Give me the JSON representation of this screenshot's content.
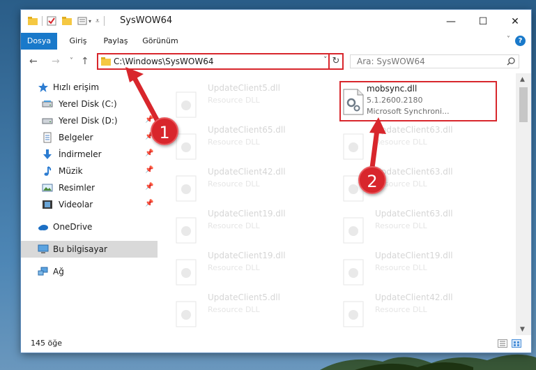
{
  "window": {
    "title": "SysWOW64",
    "minimize": "—",
    "maximize": "☐",
    "close": "✕"
  },
  "ribbon": {
    "tabs": [
      "Dosya",
      "Giriş",
      "Paylaş",
      "Görünüm"
    ],
    "help": "?"
  },
  "nav": {
    "back": "←",
    "forward": "→",
    "recent": "˅",
    "up": "↑"
  },
  "address": {
    "path": "C:\\Windows\\SysWOW64",
    "dropdown": "˅",
    "refresh": "↻"
  },
  "search": {
    "placeholder": "Ara: SysWOW64",
    "icon": "search-icon"
  },
  "sidebar": {
    "items": [
      {
        "label": "Hızlı erişim",
        "icon": "star-icon",
        "pinned": false
      },
      {
        "label": "Yerel Disk (C:)",
        "icon": "drive-icon",
        "pinned": false
      },
      {
        "label": "Yerel Disk (D:)",
        "icon": "drive-icon",
        "pinned": true
      },
      {
        "label": "Belgeler",
        "icon": "documents-icon",
        "pinned": true
      },
      {
        "label": "İndirmeler",
        "icon": "download-icon",
        "pinned": true
      },
      {
        "label": "Müzik",
        "icon": "music-icon",
        "pinned": true
      },
      {
        "label": "Resimler",
        "icon": "pictures-icon",
        "pinned": true
      },
      {
        "label": "Videolar",
        "icon": "videos-icon",
        "pinned": true
      },
      {
        "label": "OneDrive",
        "icon": "cloud-icon",
        "pinned": false
      },
      {
        "label": "Bu bilgisayar",
        "icon": "computer-icon",
        "pinned": false,
        "selected": true
      },
      {
        "label": "Ağ",
        "icon": "network-icon",
        "pinned": false
      }
    ],
    "pin_glyph": "📌"
  },
  "files": {
    "highlighted": {
      "name": "mobsync.dll",
      "version": "5.1.2600.2180",
      "description": "Microsoft Synchroni..."
    },
    "left_column": [
      {
        "name": "UpdateClient5.dll",
        "type": "Resource DLL"
      },
      {
        "name": "UpdateClient65.dll",
        "type": "Resource DLL"
      },
      {
        "name": "UpdateClient42.dll",
        "type": "Resource DLL"
      },
      {
        "name": "UpdateClient19.dll",
        "type": "Resource DLL"
      },
      {
        "name": "UpdateClient19.dll",
        "type": "Resource DLL"
      },
      {
        "name": "UpdateClient5.dll",
        "type": "Resource DLL"
      }
    ],
    "right_column": [
      {
        "name": "UpdateClient63.dll",
        "type": "Resource DLL"
      },
      {
        "name": "UpdateClient63.dll",
        "type": "Resource DLL"
      },
      {
        "name": "UpdateClient63.dll",
        "type": "Resource DLL"
      },
      {
        "name": "UpdateClient19.dll",
        "type": "Resource DLL"
      },
      {
        "name": "UpdateClient42.dll",
        "type": "Resource DLL"
      }
    ]
  },
  "status": {
    "count": "145 öğe"
  },
  "callouts": [
    "1",
    "2"
  ],
  "colors": {
    "accent": "#1979ca",
    "highlight": "#d8262c"
  }
}
